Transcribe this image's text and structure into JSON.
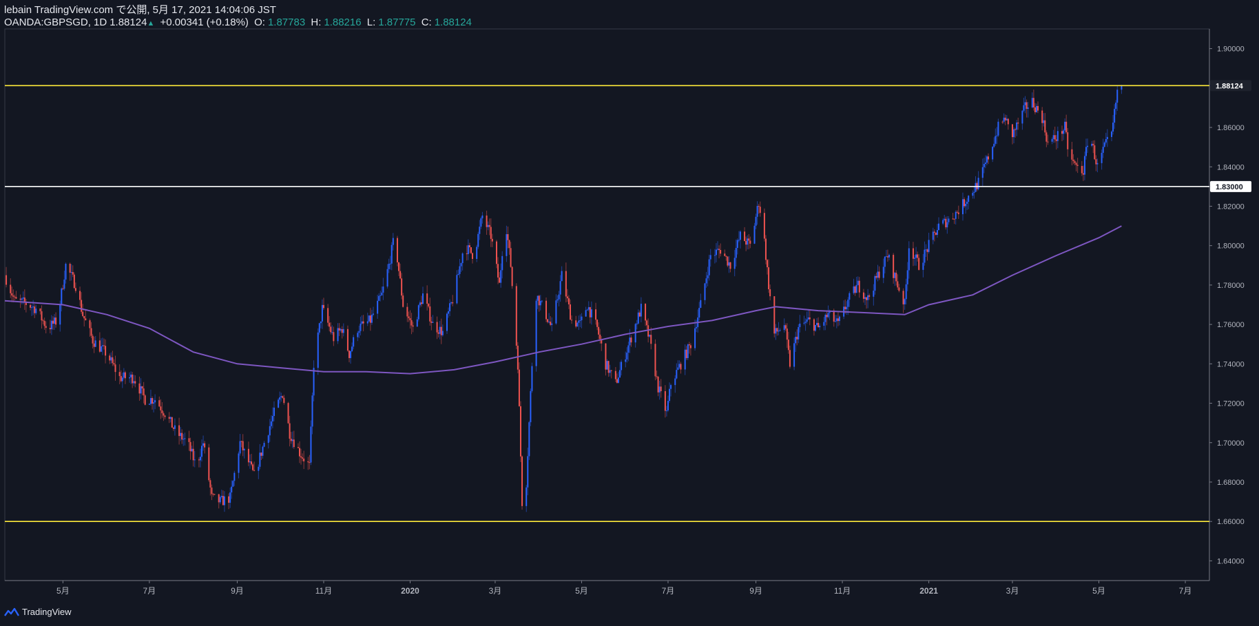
{
  "header": {
    "title": "lebain TradingView.com で公開, 5月 17, 2021 14:04:06 JST",
    "symbol": "OANDA:GBPSGD, 1D",
    "last": "1.88124",
    "change": "+0.00341 (+0.18%)",
    "o_label": "O:",
    "o_value": "1.87783",
    "h_label": "H:",
    "h_value": "1.88216",
    "l_label": "L:",
    "l_value": "1.87775",
    "c_label": "C:",
    "c_value": "1.88124"
  },
  "footer": {
    "brand": "TradingView",
    "logo_icon": "tradingview-logo-icon"
  },
  "colors": {
    "background": "#131722",
    "up": "#2962ff",
    "down": "#ef5350",
    "ma": "#7e57c2",
    "yellow_line": "#ffeb3b",
    "white_line": "#ffffff",
    "teal": "#26a69a",
    "axis_text": "#b2b5be"
  },
  "chart_data": {
    "type": "candlestick",
    "symbol": "OANDA:GBPSGD",
    "timeframe": "1D",
    "ylim": [
      1.63,
      1.91
    ],
    "y_ticks": [
      "1.90000",
      "1.86000",
      "1.84000",
      "1.82000",
      "1.80000",
      "1.78000",
      "1.76000",
      "1.74000",
      "1.72000",
      "1.70000",
      "1.68000",
      "1.66000",
      "1.64000"
    ],
    "x_range": [
      "2019-03-21",
      "2021-07-18"
    ],
    "x_ticks": [
      {
        "date": "2019-05-01",
        "label": "5月"
      },
      {
        "date": "2019-07-01",
        "label": "7月"
      },
      {
        "date": "2019-09-01",
        "label": "9月"
      },
      {
        "date": "2019-11-01",
        "label": "11月"
      },
      {
        "date": "2020-01-01",
        "label": "2020"
      },
      {
        "date": "2020-03-01",
        "label": "3月"
      },
      {
        "date": "2020-05-01",
        "label": "5月"
      },
      {
        "date": "2020-07-01",
        "label": "7月"
      },
      {
        "date": "2020-09-01",
        "label": "9月"
      },
      {
        "date": "2020-11-01",
        "label": "11月"
      },
      {
        "date": "2021-01-01",
        "label": "2021"
      },
      {
        "date": "2021-03-01",
        "label": "3月"
      },
      {
        "date": "2021-05-01",
        "label": "5月"
      },
      {
        "date": "2021-07-01",
        "label": "7月"
      }
    ],
    "horizontal_lines": [
      {
        "price": 1.88124,
        "label": "1.88124",
        "color": "yellow"
      },
      {
        "price": 1.83,
        "label": "1.83000",
        "color": "white"
      },
      {
        "price": 1.66,
        "label": "",
        "color": "yellow"
      }
    ],
    "close_path": [
      [
        "2019-03-21",
        1.785
      ],
      [
        "2019-03-28",
        1.772
      ],
      [
        "2019-04-04",
        1.771
      ],
      [
        "2019-04-12",
        1.768
      ],
      [
        "2019-04-20",
        1.758
      ],
      [
        "2019-04-27",
        1.762
      ],
      [
        "2019-05-03",
        1.79
      ],
      [
        "2019-05-10",
        1.78
      ],
      [
        "2019-05-15",
        1.765
      ],
      [
        "2019-05-22",
        1.752
      ],
      [
        "2019-06-01",
        1.745
      ],
      [
        "2019-06-10",
        1.733
      ],
      [
        "2019-06-20",
        1.733
      ],
      [
        "2019-06-28",
        1.722
      ],
      [
        "2019-07-05",
        1.722
      ],
      [
        "2019-07-12",
        1.715
      ],
      [
        "2019-07-20",
        1.705
      ],
      [
        "2019-07-28",
        1.7
      ],
      [
        "2019-08-03",
        1.688
      ],
      [
        "2019-08-08",
        1.7
      ],
      [
        "2019-08-14",
        1.672
      ],
      [
        "2019-08-20",
        1.67
      ],
      [
        "2019-08-27",
        1.672
      ],
      [
        "2019-09-03",
        1.7
      ],
      [
        "2019-09-09",
        1.69
      ],
      [
        "2019-09-13",
        1.683
      ],
      [
        "2019-09-20",
        1.7
      ],
      [
        "2019-09-27",
        1.715
      ],
      [
        "2019-10-03",
        1.725
      ],
      [
        "2019-10-08",
        1.705
      ],
      [
        "2019-10-15",
        1.695
      ],
      [
        "2019-10-22",
        1.688
      ],
      [
        "2019-10-25",
        1.74
      ],
      [
        "2019-10-31",
        1.768
      ],
      [
        "2019-11-08",
        1.753
      ],
      [
        "2019-11-14",
        1.758
      ],
      [
        "2019-11-19",
        1.745
      ],
      [
        "2019-11-25",
        1.758
      ],
      [
        "2019-12-04",
        1.762
      ],
      [
        "2019-12-12",
        1.775
      ],
      [
        "2019-12-17",
        1.79
      ],
      [
        "2019-12-21",
        1.805
      ],
      [
        "2019-12-27",
        1.77
      ],
      [
        "2020-01-03",
        1.758
      ],
      [
        "2020-01-10",
        1.775
      ],
      [
        "2020-01-17",
        1.76
      ],
      [
        "2020-01-24",
        1.756
      ],
      [
        "2020-02-01",
        1.775
      ],
      [
        "2020-02-08",
        1.8
      ],
      [
        "2020-02-15",
        1.795
      ],
      [
        "2020-02-21",
        1.815
      ],
      [
        "2020-02-27",
        1.805
      ],
      [
        "2020-03-04",
        1.78
      ],
      [
        "2020-03-08",
        1.815
      ],
      [
        "2020-03-12",
        1.79
      ],
      [
        "2020-03-17",
        1.74
      ],
      [
        "2020-03-20",
        1.67
      ],
      [
        "2020-03-23",
        1.68
      ],
      [
        "2020-03-27",
        1.74
      ],
      [
        "2020-03-30",
        1.775
      ],
      [
        "2020-04-04",
        1.768
      ],
      [
        "2020-04-10",
        1.758
      ],
      [
        "2020-04-17",
        1.785
      ],
      [
        "2020-04-24",
        1.762
      ],
      [
        "2020-04-30",
        1.76
      ],
      [
        "2020-05-05",
        1.77
      ],
      [
        "2020-05-12",
        1.758
      ],
      [
        "2020-05-18",
        1.74
      ],
      [
        "2020-05-25",
        1.73
      ],
      [
        "2020-06-01",
        1.745
      ],
      [
        "2020-06-08",
        1.76
      ],
      [
        "2020-06-12",
        1.768
      ],
      [
        "2020-06-18",
        1.752
      ],
      [
        "2020-06-24",
        1.728
      ],
      [
        "2020-06-30",
        1.715
      ],
      [
        "2020-07-03",
        1.73
      ],
      [
        "2020-07-10",
        1.74
      ],
      [
        "2020-07-17",
        1.75
      ],
      [
        "2020-07-24",
        1.77
      ],
      [
        "2020-07-31",
        1.795
      ],
      [
        "2020-08-07",
        1.798
      ],
      [
        "2020-08-14",
        1.79
      ],
      [
        "2020-08-21",
        1.805
      ],
      [
        "2020-08-28",
        1.8
      ],
      [
        "2020-09-03",
        1.822
      ],
      [
        "2020-09-06",
        1.81
      ],
      [
        "2020-09-10",
        1.78
      ],
      [
        "2020-09-14",
        1.755
      ],
      [
        "2020-09-21",
        1.76
      ],
      [
        "2020-09-25",
        1.74
      ],
      [
        "2020-10-01",
        1.758
      ],
      [
        "2020-10-08",
        1.762
      ],
      [
        "2020-10-15",
        1.758
      ],
      [
        "2020-10-22",
        1.765
      ],
      [
        "2020-10-29",
        1.76
      ],
      [
        "2020-11-05",
        1.772
      ],
      [
        "2020-11-12",
        1.78
      ],
      [
        "2020-11-19",
        1.773
      ],
      [
        "2020-11-26",
        1.785
      ],
      [
        "2020-12-03",
        1.795
      ],
      [
        "2020-12-10",
        1.78
      ],
      [
        "2020-12-15",
        1.77
      ],
      [
        "2020-12-18",
        1.8
      ],
      [
        "2020-12-25",
        1.79
      ],
      [
        "2021-01-01",
        1.8
      ],
      [
        "2021-01-08",
        1.81
      ],
      [
        "2021-01-15",
        1.813
      ],
      [
        "2021-01-22",
        1.818
      ],
      [
        "2021-01-29",
        1.825
      ],
      [
        "2021-02-05",
        1.832
      ],
      [
        "2021-02-12",
        1.845
      ],
      [
        "2021-02-19",
        1.86
      ],
      [
        "2021-02-24",
        1.865
      ],
      [
        "2021-02-28",
        1.855
      ],
      [
        "2021-03-05",
        1.862
      ],
      [
        "2021-03-10",
        1.87
      ],
      [
        "2021-03-15",
        1.873
      ],
      [
        "2021-03-22",
        1.865
      ],
      [
        "2021-03-26",
        1.852
      ],
      [
        "2021-04-01",
        1.855
      ],
      [
        "2021-04-07",
        1.86
      ],
      [
        "2021-04-10",
        1.845
      ],
      [
        "2021-04-15",
        1.84
      ],
      [
        "2021-04-20",
        1.838
      ],
      [
        "2021-04-24",
        1.858
      ],
      [
        "2021-04-30",
        1.84
      ],
      [
        "2021-05-05",
        1.85
      ],
      [
        "2021-05-10",
        1.856
      ],
      [
        "2021-05-14",
        1.878
      ],
      [
        "2021-05-17",
        1.88124
      ]
    ],
    "series": [
      {
        "kind": "moving_average",
        "values": [
          [
            "2019-03-21",
            1.772
          ],
          [
            "2019-05-01",
            1.77
          ],
          [
            "2019-06-01",
            1.765
          ],
          [
            "2019-07-01",
            1.758
          ],
          [
            "2019-08-01",
            1.746
          ],
          [
            "2019-09-01",
            1.74
          ],
          [
            "2019-10-01",
            1.738
          ],
          [
            "2019-11-01",
            1.736
          ],
          [
            "2019-12-01",
            1.736
          ],
          [
            "2020-01-01",
            1.735
          ],
          [
            "2020-02-01",
            1.737
          ],
          [
            "2020-03-01",
            1.741
          ],
          [
            "2020-04-01",
            1.746
          ],
          [
            "2020-05-01",
            1.75
          ],
          [
            "2020-06-01",
            1.755
          ],
          [
            "2020-07-01",
            1.759
          ],
          [
            "2020-08-01",
            1.762
          ],
          [
            "2020-09-01",
            1.767
          ],
          [
            "2020-09-15",
            1.769
          ],
          [
            "2020-10-15",
            1.767
          ],
          [
            "2020-11-15",
            1.766
          ],
          [
            "2020-12-15",
            1.765
          ],
          [
            "2021-01-01",
            1.77
          ],
          [
            "2021-02-01",
            1.775
          ],
          [
            "2021-03-01",
            1.785
          ],
          [
            "2021-04-01",
            1.795
          ],
          [
            "2021-05-01",
            1.804
          ],
          [
            "2021-05-17",
            1.81
          ]
        ]
      }
    ]
  }
}
